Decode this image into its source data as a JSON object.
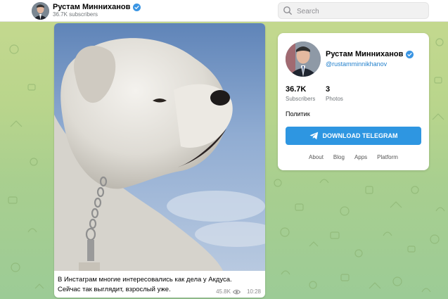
{
  "header": {
    "channel_name": "Рустам Минниханов",
    "subscribers": "36.7K subscribers",
    "search_placeholder": "Search"
  },
  "post": {
    "caption_line1": "В Инстаграм многие интересовались как дела у Акдуса.",
    "caption_line2": "Сейчас так выглядит, взрослый уже.",
    "views": "45.8K",
    "time": "10:28"
  },
  "profile": {
    "name": "Рустам Минниханов",
    "handle": "@rustamminnikhanov",
    "stats": [
      {
        "value": "36.7K",
        "label": "Subscribers"
      },
      {
        "value": "3",
        "label": "Photos"
      }
    ],
    "bio": "Политик",
    "download_label": "DOWNLOAD TELEGRAM",
    "links": [
      "About",
      "Blog",
      "Apps",
      "Platform"
    ]
  },
  "colors": {
    "accent": "#2e96e1",
    "link": "#2481cc",
    "verified": "#3a95e3"
  }
}
